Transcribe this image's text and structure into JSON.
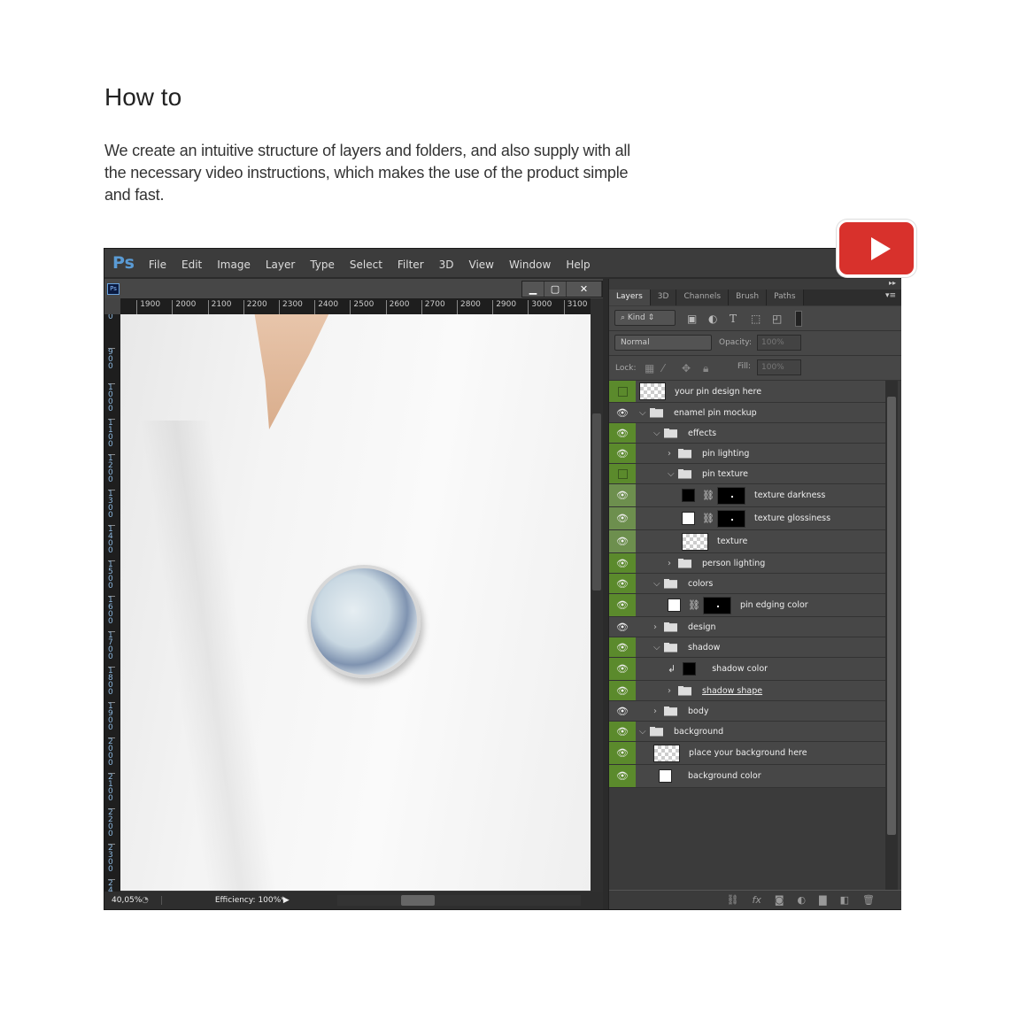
{
  "heading": "How to",
  "description": "We create an intuitive structure of layers and folders, and also supply with all the necessary video instructions, which makes the use of the product simple and fast.",
  "colors": {
    "accent_green": "#5b8a2c",
    "youtube_red": "#d8312c",
    "ps_blue": "#5a9bd5"
  },
  "app": {
    "logo": "Ps",
    "doc_icon": "Ps",
    "menu": [
      "File",
      "Edit",
      "Image",
      "Layer",
      "Type",
      "Select",
      "Filter",
      "3D",
      "View",
      "Window",
      "Help"
    ],
    "window_buttons": {
      "minimize": "▁",
      "maximize": "▢",
      "close": "✕"
    },
    "hruler": [
      "00",
      "1900",
      "2000",
      "2100",
      "2200",
      "2300",
      "2400",
      "2500",
      "2600",
      "2700",
      "2800",
      "2900",
      "3000",
      "3100"
    ],
    "vruler": [
      "0",
      "900",
      "1000",
      "1100",
      "1200",
      "1300",
      "1400",
      "1500",
      "1600",
      "1700",
      "1800",
      "1900",
      "2000",
      "2100",
      "2200",
      "2300",
      "2400"
    ],
    "zoom_level": "40,05%",
    "efficiency": "Efficiency: 100%*"
  },
  "panel": {
    "tabs": [
      "Layers",
      "3D",
      "Channels",
      "Brush",
      "Paths"
    ],
    "active_tab": "Layers",
    "filter_kind": "Kind",
    "blend_mode": "Normal",
    "opacity_label": "Opacity:",
    "opacity": "100%",
    "lock_label": "Lock:",
    "fill_label": "Fill:",
    "fill": "100%",
    "layers": [
      {
        "name": "your pin design here",
        "visible": false,
        "indent": 0,
        "kind": "smart",
        "eye": "green"
      },
      {
        "name": "enamel pin mockup",
        "visible": true,
        "indent": 0,
        "kind": "group",
        "open": true,
        "eye": "gray"
      },
      {
        "name": "effects",
        "visible": true,
        "indent": 1,
        "kind": "group",
        "open": true,
        "eye": "green"
      },
      {
        "name": "pin lighting",
        "visible": true,
        "indent": 2,
        "kind": "group",
        "open": false,
        "eye": "green"
      },
      {
        "name": "pin texture",
        "visible": false,
        "indent": 2,
        "kind": "group",
        "open": true,
        "eye": "green"
      },
      {
        "name": "texture darkness",
        "visible": true,
        "indent": 3,
        "kind": "fill",
        "swatch": "#000000",
        "eye": "light"
      },
      {
        "name": "texture glossiness",
        "visible": true,
        "indent": 3,
        "kind": "fill",
        "swatch": "#ffffff",
        "eye": "light"
      },
      {
        "name": "texture",
        "visible": true,
        "indent": 3,
        "kind": "pixel",
        "eye": "light"
      },
      {
        "name": "person lighting",
        "visible": true,
        "indent": 2,
        "kind": "group",
        "open": false,
        "eye": "green"
      },
      {
        "name": "colors",
        "visible": true,
        "indent": 1,
        "kind": "group",
        "open": true,
        "eye": "green"
      },
      {
        "name": "pin edging color",
        "visible": true,
        "indent": 2,
        "kind": "fill",
        "swatch": "#ffffff",
        "eye": "green"
      },
      {
        "name": "design",
        "visible": true,
        "indent": 1,
        "kind": "group",
        "open": false,
        "eye": "gray"
      },
      {
        "name": "shadow",
        "visible": true,
        "indent": 1,
        "kind": "group",
        "open": true,
        "eye": "green"
      },
      {
        "name": "shadow color",
        "visible": true,
        "indent": 2,
        "kind": "clipped",
        "swatch": "#000000",
        "eye": "green"
      },
      {
        "name": "shadow shape",
        "visible": true,
        "indent": 2,
        "kind": "group",
        "open": false,
        "eye": "green",
        "underline": true
      },
      {
        "name": "body",
        "visible": true,
        "indent": 1,
        "kind": "group",
        "open": false,
        "eye": "gray"
      },
      {
        "name": "background",
        "visible": true,
        "indent": 0,
        "kind": "group",
        "open": true,
        "eye": "green"
      },
      {
        "name": "place your background here",
        "visible": true,
        "indent": 1,
        "kind": "pixel",
        "eye": "green"
      },
      {
        "name": "background color",
        "visible": true,
        "indent": 1,
        "kind": "solid",
        "swatch": "#ffffff",
        "eye": "green"
      }
    ]
  }
}
